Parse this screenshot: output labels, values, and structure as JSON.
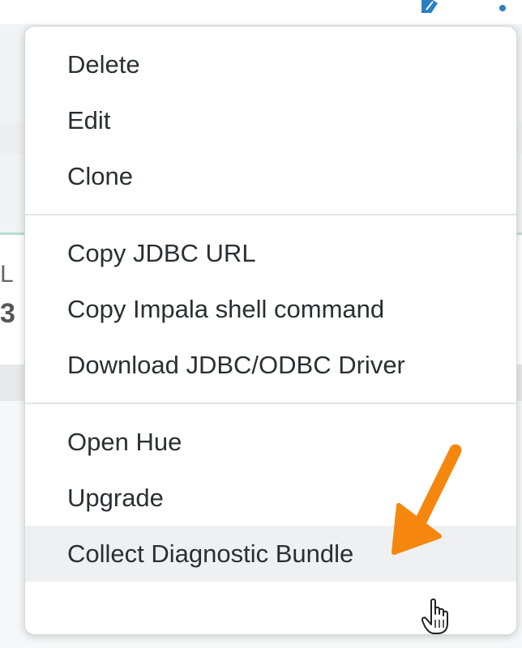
{
  "menu": {
    "groups": [
      {
        "items": [
          {
            "label": "Delete"
          },
          {
            "label": "Edit"
          },
          {
            "label": "Clone"
          }
        ]
      },
      {
        "items": [
          {
            "label": "Copy JDBC URL"
          },
          {
            "label": "Copy Impala shell command"
          },
          {
            "label": "Download JDBC/ODBC Driver"
          }
        ]
      },
      {
        "items": [
          {
            "label": "Open Hue"
          },
          {
            "label": "Upgrade"
          },
          {
            "label": "Collect Diagnostic Bundle"
          }
        ]
      }
    ],
    "highlighted_item": "Collect Diagnostic Bundle"
  },
  "background": {
    "edge_glyph_1": "L",
    "edge_glyph_2": "3"
  },
  "icons": {
    "top_edit": "edit-icon",
    "top_dot": "status-dot-icon",
    "annotation": "arrow-annotation",
    "cursor": "hand-pointer-cursor"
  },
  "colors": {
    "accent_arrow": "#f5870f",
    "status_dot": "#2a7fc1",
    "menu_hover": "#eef0f2",
    "accent_green_line": "#b6dfd2"
  }
}
